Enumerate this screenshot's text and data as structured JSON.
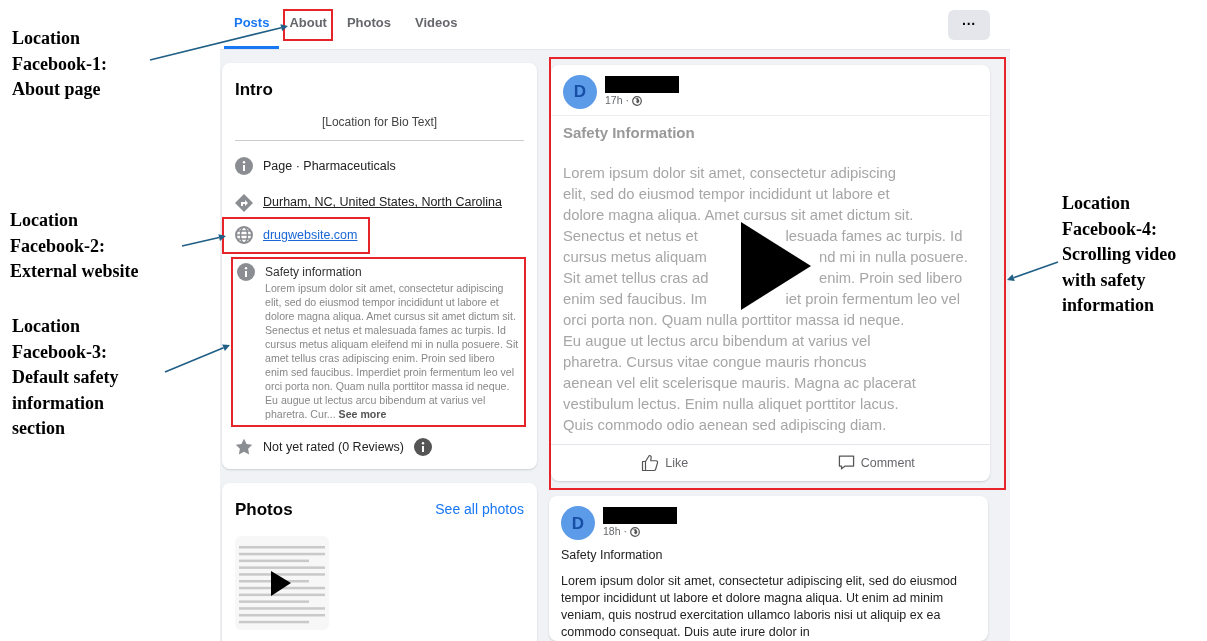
{
  "annotations": [
    {
      "text": "Location\nFacebook-1:\nAbout page"
    },
    {
      "text": "Location\nFacebook-2:\nExternal website"
    },
    {
      "text": "Location\nFacebook-3:\nDefault safety\ninformation\nsection"
    },
    {
      "text": "Location\nFacebook-4:\nScrolling video\nwith safety\ninformation"
    }
  ],
  "tabs": [
    {
      "label": "Posts",
      "selected": true,
      "highlighted": false
    },
    {
      "label": "About",
      "selected": false,
      "highlighted": true
    },
    {
      "label": "Photos",
      "selected": false,
      "highlighted": false
    },
    {
      "label": "Videos",
      "selected": false,
      "highlighted": false
    }
  ],
  "more_button": "···",
  "intro": {
    "title": "Intro",
    "bio": "[Location for Bio Text]",
    "items": [
      {
        "kind": "category",
        "text": "Page · Pharmaceuticals",
        "highlighted": false
      },
      {
        "kind": "location",
        "text": "Durham, NC, United States, North Carolina",
        "highlighted": false
      },
      {
        "kind": "website",
        "text": "drugwebsite.com",
        "highlighted": true
      },
      {
        "kind": "safety",
        "title": "Safety information",
        "text": "Lorem ipsum dolor sit amet, consectetur adipiscing elit, sed do eiusmod tempor incididunt ut labore et dolore magna aliqua. Amet cursus sit amet dictum sit. Senectus et netus et malesuada fames ac turpis. Id cursus metus aliquam eleifend mi in nulla posuere. Sit amet tellus cras adipiscing enim. Proin sed libero enim sed faucibus. Imperdiet proin fermentum leo vel orci porta non. Quam nulla porttitor massa id neque. Eu augue ut lectus arcu bibendum at varius vel pharetra. Cur...",
        "more": "See more",
        "highlighted": true
      },
      {
        "kind": "rating",
        "text": "Not yet rated (0 Reviews)",
        "highlighted": false
      }
    ]
  },
  "photos": {
    "title": "Photos",
    "link": "See all photos"
  },
  "posts": [
    {
      "kind": "video",
      "avatar": "D",
      "time": "17h ·",
      "title": "Safety Information",
      "lines": [
        [
          "Lorem ipsum dolor sit amet, consectetur adipiscing"
        ],
        [
          "elit, sed do eiusmod tempor incididunt ut labore et"
        ],
        [
          "dolore magna aliqua. Amet cursus sit amet dictum sit."
        ],
        [
          "Senectus et netus et",
          "lesuada fames ac turpis. Id"
        ],
        [
          "cursus metus aliquam",
          "nd mi in nulla posuere."
        ],
        [
          "Sit amet tellus cras ad",
          "enim. Proin sed libero"
        ],
        [
          "enim sed faucibus. Im",
          "iet proin fermentum leo vel"
        ],
        [
          "orci porta non. Quam nulla porttitor massa id neque."
        ],
        [
          "Eu augue ut lectus arcu bibendum at varius vel"
        ],
        [
          "pharetra. Cursus vitae congue mauris rhoncus"
        ],
        [
          "aenean vel elit scelerisque mauris. Magna ac placerat"
        ],
        [
          "vestibulum lectus. Enim nulla aliquet porttitor lacus."
        ],
        [
          "Quis commodo odio aenean sed adipiscing diam."
        ]
      ],
      "actions": [
        "Like",
        "Comment"
      ],
      "highlighted": true
    },
    {
      "kind": "text",
      "avatar": "D",
      "time": "18h ·",
      "title": "Safety Information",
      "text": "Lorem ipsum dolor sit amet, consectetur adipiscing elit, sed do eiusmod tempor incididunt ut labore et dolore magna aliqua. Ut enim ad minim veniam, quis nostrud exercitation ullamco laboris nisi ut aliquip ex ea commodo consequat. Duis aute irure dolor in",
      "highlighted": false
    }
  ]
}
